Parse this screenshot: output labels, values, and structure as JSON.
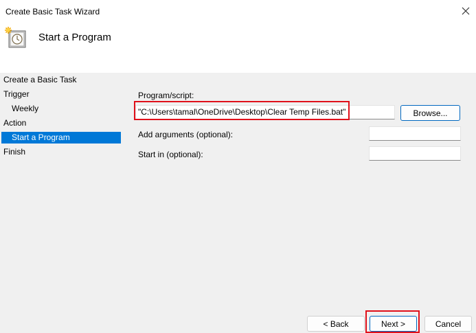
{
  "window": {
    "title": "Create Basic Task Wizard"
  },
  "header": {
    "title": "Start a Program",
    "icon": "task-scheduler-clock-icon"
  },
  "nav": {
    "items": [
      {
        "label": "Create a Basic Task"
      },
      {
        "label": "Trigger"
      },
      {
        "label": "Weekly"
      },
      {
        "label": "Action"
      },
      {
        "label": "Start a Program",
        "selected": true
      },
      {
        "label": "Finish"
      }
    ]
  },
  "form": {
    "program_label": "Program/script:",
    "program_value": "\"C:\\Users\\tamal\\OneDrive\\Desktop\\Clear Temp Files.bat\"",
    "browse_label": "Browse...",
    "arguments_label": "Add arguments (optional):",
    "arguments_value": "",
    "startin_label": "Start in (optional):",
    "startin_value": ""
  },
  "buttons": {
    "back": "< Back",
    "next": "Next >",
    "cancel": "Cancel"
  },
  "colors": {
    "selection": "#0078d7",
    "highlight_box": "#e0101a",
    "accent_border": "#0067c0"
  }
}
